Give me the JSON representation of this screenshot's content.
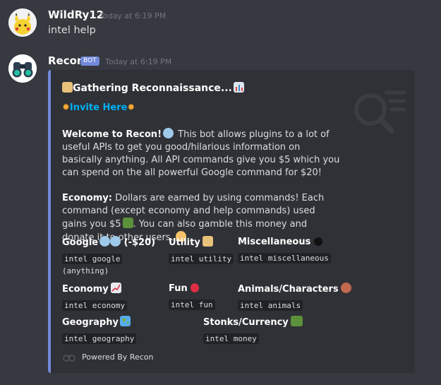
{
  "messages": [
    {
      "author": "WildRy12",
      "timestamp": "Today at 6:19 PM",
      "text": "intel help"
    },
    {
      "author": "Recon",
      "badge": "BOT",
      "timestamp": "Today at 6:19 PM"
    }
  ],
  "embed": {
    "accent_color": "#7289da",
    "title": "Gathering Reconnaissance...",
    "invite_label": "Invite Here",
    "welcome_bold": "Welcome to Recon!",
    "welcome_text": "This bot allows plugins to a lot of useful APIs to get you good/hilarious information on basically anything. All API commands give you $5 which you can spend on the all powerful Google command for $20!",
    "economy_bold": "Economy:",
    "economy_text": "Dollars are earned by using commands! Each command (except economy and help commands) used gains you $5",
    "economy_text2": ". You can also gamble this money and donate it to other users.",
    "fields": [
      {
        "name": "Google",
        "extra": "(-$20)",
        "value": "intel google",
        "plain": "(anything)",
        "icon": "magnifier-icon"
      },
      {
        "name": "Utility",
        "value": "intel utility",
        "icon": "scroll-icon"
      },
      {
        "name": "Miscellaneous",
        "value": "intel miscellaneous",
        "icon": "eight-ball-icon"
      },
      {
        "name": "Economy",
        "value": "intel economy",
        "icon": "chart-up-icon"
      },
      {
        "name": "Fun",
        "value": "intel fun",
        "icon": "balloon-icon"
      },
      {
        "name": "Animals/Characters",
        "value": "intel animals",
        "icon": "monkey-icon"
      },
      {
        "name": "Geography",
        "value": "intel geography",
        "icon": "map-icon"
      },
      {
        "name": "Stonks/Currency",
        "value": "intel money",
        "icon": "money-icon"
      }
    ],
    "footer": "Powered By Recon"
  }
}
